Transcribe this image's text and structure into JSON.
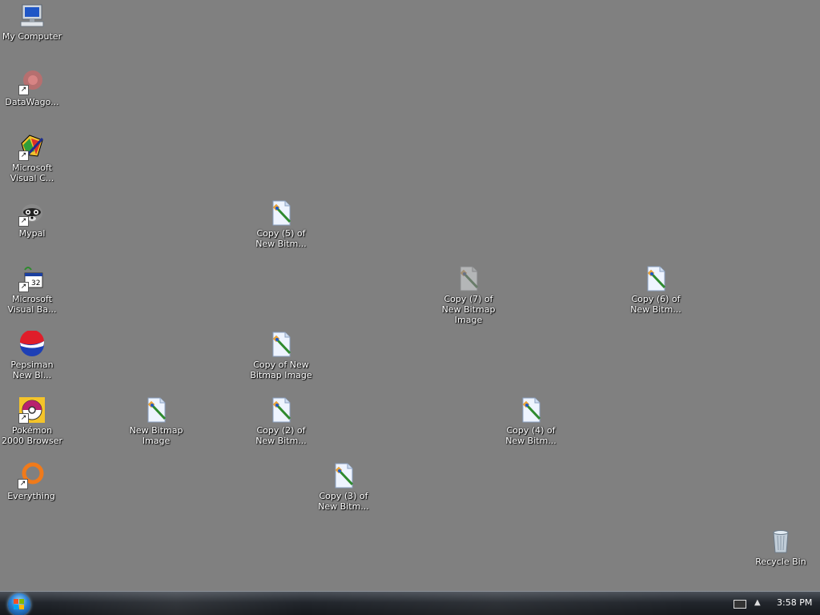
{
  "desktop": {
    "icons": [
      {
        "id": "my-computer",
        "label": "My Computer",
        "icon": "computer-icon"
      },
      {
        "id": "datawagon",
        "label": "DataWago...",
        "icon": "datawagon-icon",
        "shortcut": true
      },
      {
        "id": "ms-visual-c",
        "label": "Microsoft Visual C...",
        "icon": "visual-c-icon",
        "shortcut": true
      },
      {
        "id": "mypal",
        "label": "Mypal",
        "icon": "raccoon-icon",
        "shortcut": true
      },
      {
        "id": "ms-visual-basic",
        "label": "Microsoft Visual Ba...",
        "icon": "visual-basic-icon",
        "shortcut": true
      },
      {
        "id": "pepsiman",
        "label": "Pepsiman New Bl...",
        "icon": "pepsi-icon",
        "shortcut": true
      },
      {
        "id": "pokemon-browser",
        "label": "Pokémon 2000 Browser",
        "icon": "pokeball-icon",
        "shortcut": true
      },
      {
        "id": "everything",
        "label": "Everything",
        "icon": "everything-icon",
        "shortcut": true
      },
      {
        "id": "new-bitmap",
        "label": "New Bitmap Image",
        "icon": "bitmap-file-icon"
      },
      {
        "id": "copy5",
        "label": "Copy (5) of New Bitm...",
        "icon": "bitmap-file-icon"
      },
      {
        "id": "copy-of",
        "label": "Copy of New Bitmap Image",
        "icon": "bitmap-file-icon"
      },
      {
        "id": "copy2",
        "label": "Copy (2) of New Bitm...",
        "icon": "bitmap-file-icon"
      },
      {
        "id": "copy3",
        "label": "Copy (3) of New Bitm...",
        "icon": "bitmap-file-icon"
      },
      {
        "id": "copy7",
        "label": "Copy (7) of New Bitmap Image",
        "icon": "bitmap-file-icon"
      },
      {
        "id": "copy4",
        "label": "Copy (4) of New Bitm...",
        "icon": "bitmap-file-icon"
      },
      {
        "id": "copy6",
        "label": "Copy (6) of New Bitm...",
        "icon": "bitmap-file-icon"
      },
      {
        "id": "recycle-bin",
        "label": "Recycle Bin",
        "icon": "recycle-bin-icon"
      }
    ]
  },
  "taskbar": {
    "start_icon": "windows-orb-icon",
    "tray_icons": [
      "keyboard-icon",
      "show-hidden-icons-icon"
    ],
    "clock": "3:58 PM"
  }
}
